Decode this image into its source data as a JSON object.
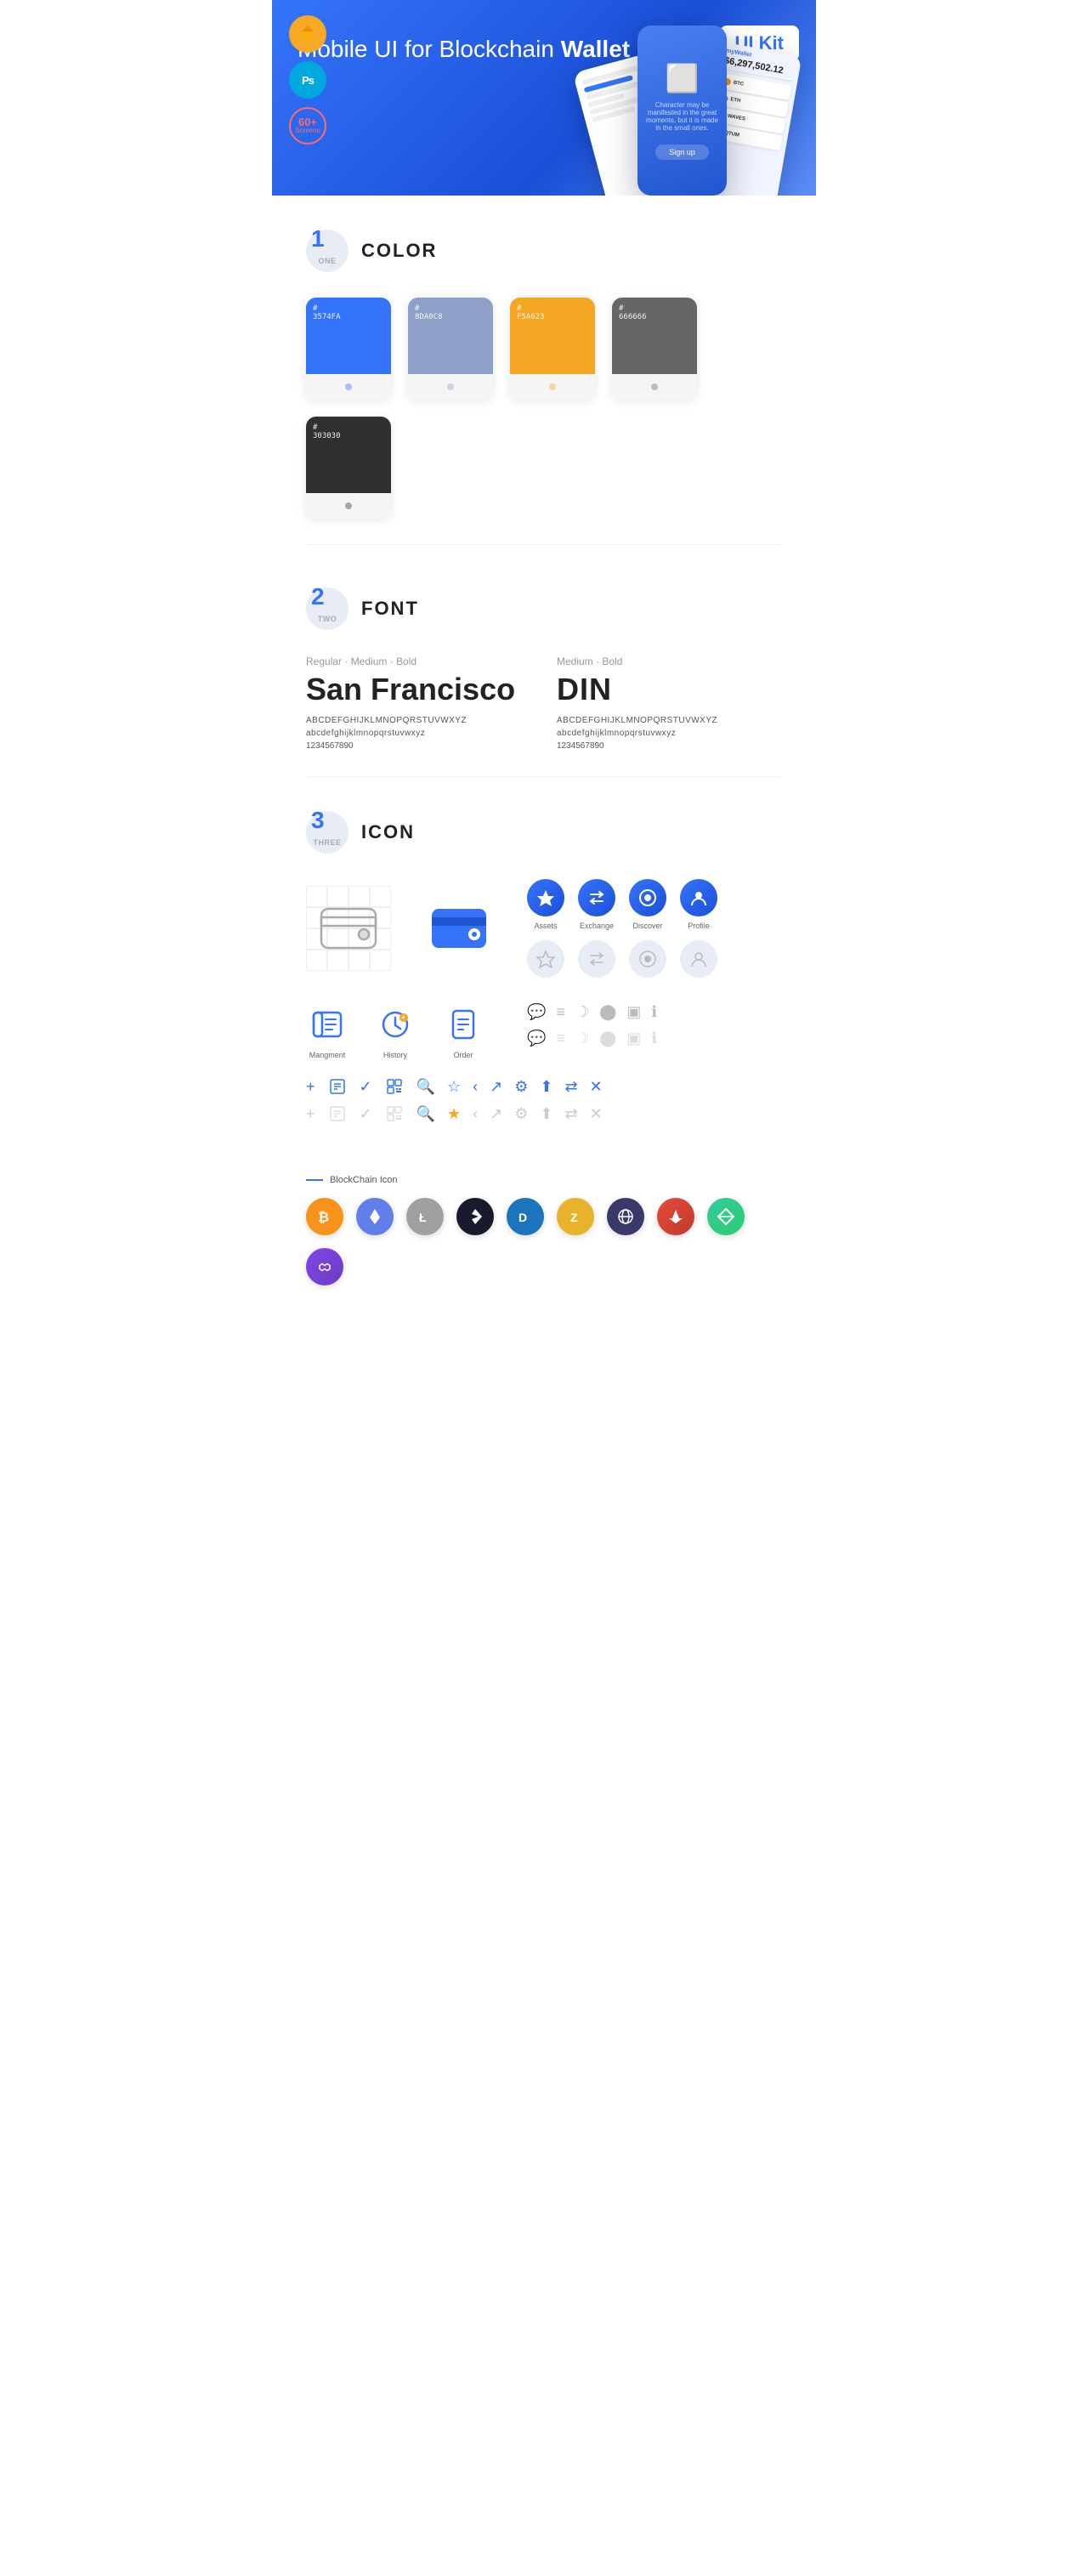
{
  "hero": {
    "title": "Mobile UI for Blockchain ",
    "title_bold": "Wallet",
    "badge": "UI Kit",
    "badges": {
      "sketch": "S",
      "ps": "Ps",
      "screens": "60+\nScreens"
    }
  },
  "sections": {
    "color": {
      "number": "1",
      "number_word": "ONE",
      "title": "COLOR",
      "swatches": [
        {
          "hex": "#3574FA",
          "label": "#\n3574FA",
          "dot_color": "#fff"
        },
        {
          "hex": "#8DA0C8",
          "label": "#\n8DA0C8",
          "dot_color": "#fff"
        },
        {
          "hex": "#F5A623",
          "label": "#\nF5A623",
          "dot_color": "#fff"
        },
        {
          "hex": "#666666",
          "label": "#\n666666",
          "dot_color": "#fff"
        },
        {
          "hex": "#303030",
          "label": "#\n303030",
          "dot_color": "#fff"
        }
      ]
    },
    "font": {
      "number": "2",
      "number_word": "TWO",
      "title": "FONT",
      "font1": {
        "weights": "Regular · Medium · Bold",
        "name": "San Francisco",
        "uppercase": "ABCDEFGHIJKLMNOPQRSTUVWXYZ",
        "lowercase": "abcdefghijklmnopqrstuvwxyz",
        "numbers": "1234567890"
      },
      "font2": {
        "weights": "Medium · Bold",
        "name": "DIN",
        "uppercase": "ABCDEFGHIJKLMNOPQRSTUVWXYZ",
        "lowercase": "abcdefghijklmnopqrstuvwxyz",
        "numbers": "1234567890"
      }
    },
    "icon": {
      "number": "3",
      "number_word": "THREE",
      "title": "ICON",
      "nav_icons": [
        {
          "label": "Assets",
          "icon": "◆"
        },
        {
          "label": "Exchange",
          "icon": "⇌"
        },
        {
          "label": "Discover",
          "icon": "◉"
        },
        {
          "label": "Profile",
          "icon": "👤"
        }
      ],
      "app_icons": [
        {
          "label": "Mangment",
          "icon": "▣"
        },
        {
          "label": "History",
          "icon": "🕐"
        },
        {
          "label": "Order",
          "icon": "📋"
        }
      ],
      "blockchain_label": "BlockChain Icon",
      "crypto_icons": [
        {
          "name": "Bitcoin",
          "symbol": "₿",
          "color": "#F7931A"
        },
        {
          "name": "Ethereum",
          "symbol": "Ξ",
          "color": "#627EEA"
        },
        {
          "name": "Litecoin",
          "symbol": "Ł",
          "color": "#A0A0A0"
        },
        {
          "name": "Stratis",
          "symbol": "S",
          "color": "#1388c7"
        },
        {
          "name": "Dash",
          "symbol": "D",
          "color": "#1c75bc"
        },
        {
          "name": "Zcash",
          "symbol": "Z",
          "color": "#e8b32a"
        },
        {
          "name": "Gem",
          "symbol": "✦",
          "color": "#5a5a8c"
        },
        {
          "name": "Ark",
          "symbol": "A",
          "color": "#f70000"
        },
        {
          "name": "Kyber",
          "symbol": "◈",
          "color": "#31cb9e"
        },
        {
          "name": "Polygon",
          "symbol": "⬡",
          "color": "#8247e5"
        }
      ]
    }
  }
}
